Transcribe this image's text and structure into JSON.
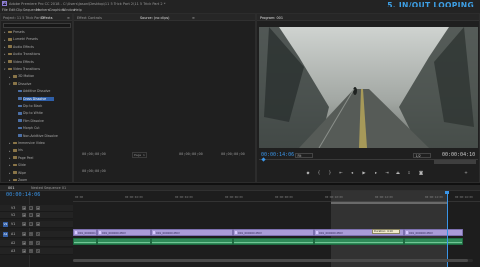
{
  "titlebar": {
    "app_icon_label": "Pr",
    "title": "Adobe Premiere Pro CC 2018 - C:\\Users\\Jason\\Desktop\\11 5 Trick Part 2\\11 5 Trick Part 2 *"
  },
  "overlay_title": "5. IN/OUT LOOPING",
  "menu": [
    "File",
    "Edit",
    "Clip",
    "Sequence",
    "Markers",
    "Graphics",
    "Window",
    "Help"
  ],
  "effects_panel": {
    "tabs": [
      "Project: 11 5 Trick Part 2",
      "Effects",
      "≡"
    ],
    "items": [
      {
        "label": "Presets",
        "depth": 0,
        "type": "folder"
      },
      {
        "label": "Lumetri Presets",
        "depth": 0,
        "type": "folder"
      },
      {
        "label": "Audio Effects",
        "depth": 0,
        "type": "folder"
      },
      {
        "label": "Audio Transitions",
        "depth": 0,
        "type": "folder"
      },
      {
        "label": "Video Effects",
        "depth": 0,
        "type": "folder"
      },
      {
        "label": "Video Transitions",
        "depth": 0,
        "type": "folder",
        "open": true
      },
      {
        "label": "3D Motion",
        "depth": 1,
        "type": "folder"
      },
      {
        "label": "Dissolve",
        "depth": 1,
        "type": "folder",
        "open": true
      },
      {
        "label": "Additive Dissolve",
        "depth": 2,
        "type": "fx"
      },
      {
        "label": "Cross Dissolve",
        "depth": 2,
        "type": "fx",
        "selected": true
      },
      {
        "label": "Dip to Black",
        "depth": 2,
        "type": "fx"
      },
      {
        "label": "Dip to White",
        "depth": 2,
        "type": "fx"
      },
      {
        "label": "Film Dissolve",
        "depth": 2,
        "type": "fx"
      },
      {
        "label": "Morph Cut",
        "depth": 2,
        "type": "fx"
      },
      {
        "label": "Non-Additive Dissolve",
        "depth": 2,
        "type": "fx"
      },
      {
        "label": "Immersive Video",
        "depth": 1,
        "type": "folder"
      },
      {
        "label": "Iris",
        "depth": 1,
        "type": "folder"
      },
      {
        "label": "Page Peel",
        "depth": 1,
        "type": "folder"
      },
      {
        "label": "Slide",
        "depth": 1,
        "type": "folder"
      },
      {
        "label": "Wipe",
        "depth": 1,
        "type": "folder"
      },
      {
        "label": "Zoom",
        "depth": 1,
        "type": "folder"
      }
    ]
  },
  "source_panel": {
    "tabs": [
      "Effect Controls",
      "Source: (no clips)",
      "≡"
    ],
    "left_tc": "00;00;00;00",
    "right_tc": "00;00;00;00",
    "mid_left_tc": "00;00;00;00",
    "mid_right_tc": "00;00;00;00",
    "page_label": "Page 1"
  },
  "program_panel": {
    "tab": "Program: 001",
    "timecode": "00:00:14:06",
    "fit": "Fit",
    "quality": "1/2",
    "duration": "00:00:04:10"
  },
  "timeline": {
    "tabs": [
      "001",
      "Nested Sequence 01"
    ],
    "timecode": "00:00:14:06",
    "ruler_ticks": [
      "00:00",
      "00:00:02:00",
      "00:00:04:00",
      "00:00:06:00",
      "00:00:08:00",
      "00:00:10:00",
      "00:00:12:00",
      "00:00:14:00",
      "00:00:16:00"
    ],
    "tracks": [
      {
        "name": "V3",
        "target": false
      },
      {
        "name": "V2",
        "target": false
      },
      {
        "name": "V1",
        "target": true
      },
      {
        "name": "A1",
        "target": true
      },
      {
        "name": "A2",
        "target": false
      },
      {
        "name": "A3",
        "target": false
      }
    ],
    "video_clips": [
      "001_000000.MOV",
      "001_000000.MOV",
      "001_000000.MOV",
      "001_000000.MOV",
      "001_000000.MOV",
      "001_000000.MOV"
    ],
    "tooltip": "Duration: 4:10"
  },
  "colors": {
    "accent": "#3a95e8",
    "video_clip": "#a99cd8",
    "audio_clip": "#2f8a58",
    "selection": "#2f5fa8"
  }
}
